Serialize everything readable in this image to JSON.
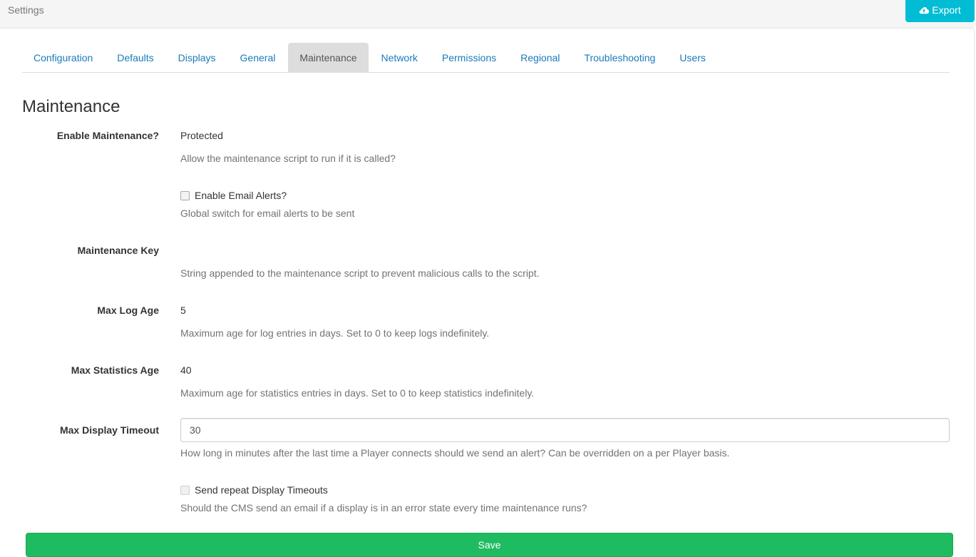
{
  "header": {
    "title": "Settings",
    "export_label": "Export",
    "export_icon": "cloud-upload-icon"
  },
  "tabs": [
    {
      "label": "Configuration",
      "active": false
    },
    {
      "label": "Defaults",
      "active": false
    },
    {
      "label": "Displays",
      "active": false
    },
    {
      "label": "General",
      "active": false
    },
    {
      "label": "Maintenance",
      "active": true
    },
    {
      "label": "Network",
      "active": false
    },
    {
      "label": "Permissions",
      "active": false
    },
    {
      "label": "Regional",
      "active": false
    },
    {
      "label": "Troubleshooting",
      "active": false
    },
    {
      "label": "Users",
      "active": false
    }
  ],
  "section": {
    "title": "Maintenance",
    "enable_maintenance": {
      "label": "Enable Maintenance?",
      "value": "Protected",
      "help": "Allow the maintenance script to run if it is called?"
    },
    "email_alerts": {
      "label": "Enable Email Alerts?",
      "checked": false,
      "help": "Global switch for email alerts to be sent"
    },
    "maintenance_key": {
      "label": "Maintenance Key",
      "value": "",
      "help": "String appended to the maintenance script to prevent malicious calls to the script."
    },
    "max_log_age": {
      "label": "Max Log Age",
      "value": "5",
      "help": "Maximum age for log entries in days. Set to 0 to keep logs indefinitely."
    },
    "max_statistics_age": {
      "label": "Max Statistics Age",
      "value": "40",
      "help": "Maximum age for statistics entries in days. Set to 0 to keep statistics indefinitely."
    },
    "max_display_timeout": {
      "label": "Max Display Timeout",
      "value": "30",
      "help": "How long in minutes after the last time a Player connects should we send an alert? Can be overridden on a per Player basis."
    },
    "repeat_timeouts": {
      "label": "Send repeat Display Timeouts",
      "checked": false,
      "disabled": true,
      "help": "Should the CMS send an email if a display is in an error state every time maintenance runs?"
    }
  },
  "footer": {
    "save_label": "Save"
  },
  "colors": {
    "export_button": "#00bcd4",
    "save_button": "#1fbb61",
    "tab_link": "#1a7bb9",
    "active_tab_bg": "#dddddd"
  }
}
